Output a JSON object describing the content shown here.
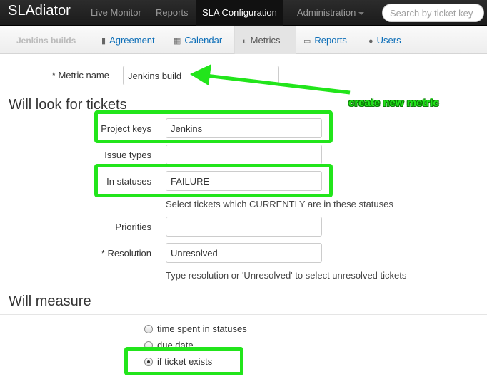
{
  "navbar": {
    "brand": "SLAdiator",
    "items": [
      {
        "label": "Live Monitor"
      },
      {
        "label": "Reports"
      },
      {
        "label": "SLA Configuration",
        "active": true
      },
      {
        "label": "Administration",
        "dropdown": true
      }
    ],
    "search_placeholder": "Search by ticket key"
  },
  "subnav": {
    "title": "Jenkins builds",
    "items": [
      {
        "label": "Agreement",
        "icon": "document-icon"
      },
      {
        "label": "Calendar",
        "icon": "calendar-icon"
      },
      {
        "label": "Metrics",
        "icon": "half-circle-icon",
        "active": true
      },
      {
        "label": "Reports",
        "icon": "folder-icon"
      },
      {
        "label": "Users",
        "icon": "user-icon"
      }
    ]
  },
  "form": {
    "metric_name_label": "* Metric name",
    "metric_name_value": "Jenkins build",
    "section1": "Will look for tickets",
    "project_keys_label": "Project keys",
    "project_keys_value": "Jenkins",
    "issue_types_label": "Issue types",
    "issue_types_value": "",
    "statuses_label": "In statuses",
    "statuses_value": "FAILURE",
    "statuses_help": "Select tickets which CURRENTLY are in these statuses",
    "priorities_label": "Priorities",
    "priorities_value": "",
    "resolution_label": "* Resolution",
    "resolution_value": "Unresolved",
    "resolution_help": "Type resolution or 'Unresolved' to select unresolved tickets",
    "section2": "Will measure",
    "measure_options": [
      {
        "label": "time spent in statuses",
        "checked": false
      },
      {
        "label": "due date",
        "checked": false
      },
      {
        "label": "if ticket exists",
        "checked": true
      }
    ]
  },
  "annotation": {
    "text": "create new metric",
    "color": "#22e51b"
  }
}
